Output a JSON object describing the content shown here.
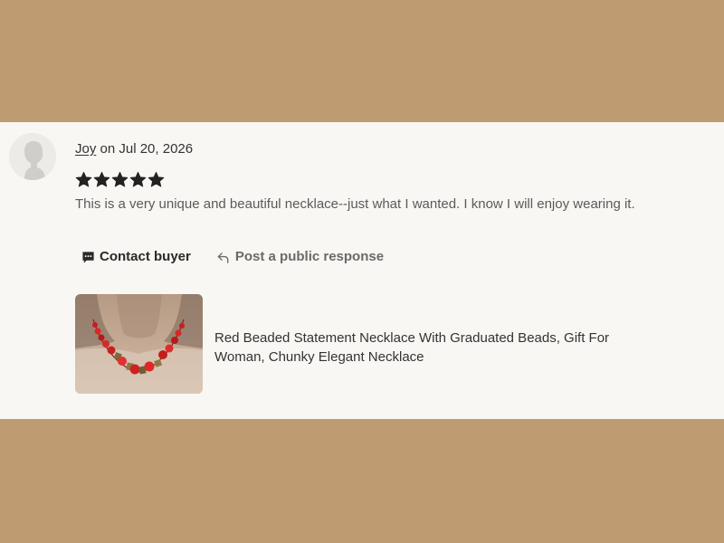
{
  "review": {
    "reviewer_name": "Joy",
    "date_text": " on Jul 20, 2026",
    "rating": 5,
    "rating_max": 5,
    "text": "This is a very unique and beautiful necklace--just what I wanted. I know I will enjoy wearing it."
  },
  "actions": {
    "contact_label": "Contact buyer",
    "public_response_label": "Post a public response"
  },
  "listing": {
    "title": "Red Beaded Statement Necklace With Graduated Beads, Gift For Woman, Chunky Elegant Necklace"
  },
  "icons": {
    "avatar": "default-user-avatar-icon",
    "star": "star-icon",
    "contact": "chat-bubble-icon",
    "reply": "reply-arrow-icon"
  },
  "colors": {
    "page_background": "#bf9b72",
    "card_background": "#f8f7f4",
    "star_color": "#222222"
  }
}
